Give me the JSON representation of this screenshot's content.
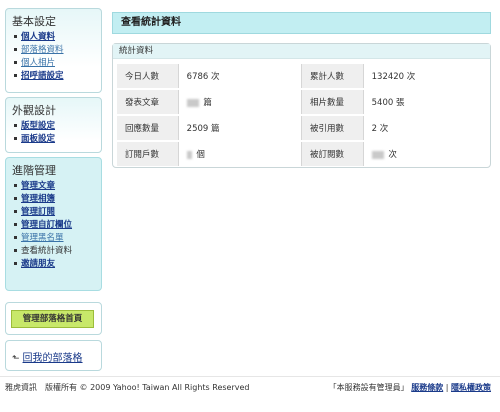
{
  "sidebar": {
    "basic": {
      "title": "基本設定",
      "items": [
        "個人資料",
        "部落格資料",
        "個人相片",
        "招呼語設定"
      ]
    },
    "look": {
      "title": "外觀設計",
      "items": [
        "版型設定",
        "面板設定"
      ]
    },
    "advanced": {
      "title": "進階管理",
      "items": [
        "管理文章",
        "管理相簿",
        "管理訂閱",
        "管理自訂欄位",
        "管理黑名單",
        "查看統計資料",
        "邀請朋友"
      ]
    },
    "home_button": "管理部落格首頁",
    "back_link": "回我的部落格"
  },
  "main": {
    "title": "查看統計資料",
    "panel_title": "統計資料",
    "rows": [
      [
        {
          "label": "今日人數",
          "value": "6786 次"
        },
        {
          "label": "累計人數",
          "value": "132420 次"
        }
      ],
      [
        {
          "label": "發表文章",
          "value": "篇"
        },
        {
          "label": "相片數量",
          "value": "5400 張"
        }
      ],
      [
        {
          "label": "回應數量",
          "value": "2509 篇"
        },
        {
          "label": "被引用數",
          "value": "2 次"
        }
      ],
      [
        {
          "label": "訂閱戶數",
          "value": "個"
        },
        {
          "label": "被訂閱數",
          "value": "次"
        }
      ]
    ]
  },
  "footer": {
    "left": "雅虎資訊　版權所有 © 2009 Yahoo! Taiwan All Rights Reserved",
    "notice": "「本服務設有管理員」",
    "terms": "服務條款",
    "separator": "|",
    "privacy": "隱私權政策"
  }
}
